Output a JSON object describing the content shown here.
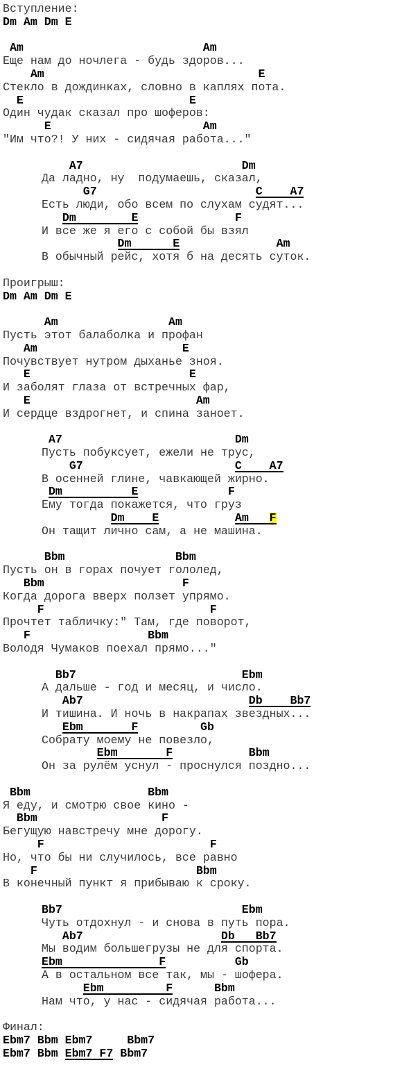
{
  "song": {
    "lines": [
      {
        "type": "label",
        "text": "Вступление:"
      },
      {
        "type": "chords",
        "segments": [
          {
            "t": "Dm Am Dm E"
          }
        ]
      },
      {
        "type": "blank"
      },
      {
        "type": "chords",
        "segments": [
          {
            "t": " Am                          Am"
          }
        ]
      },
      {
        "type": "lyric",
        "text": "Еще нам до ночлега - будь здоров..."
      },
      {
        "type": "chords",
        "segments": [
          {
            "t": "    Am                               E"
          }
        ]
      },
      {
        "type": "lyric",
        "text": "Стекло в дождинках, словно в каплях пота."
      },
      {
        "type": "chords",
        "segments": [
          {
            "t": "  E                        E"
          }
        ]
      },
      {
        "type": "lyric",
        "text": "Один чудак сказал про шоферов:"
      },
      {
        "type": "chords",
        "segments": [
          {
            "t": "      E                      Am"
          }
        ]
      },
      {
        "type": "lyric",
        "text": "\"Им что?! У них - сидячая работа...\""
      },
      {
        "type": "blank"
      },
      {
        "type": "chords",
        "indent": true,
        "segments": [
          {
            "t": "    A7                       Dm"
          }
        ]
      },
      {
        "type": "lyric",
        "indent": true,
        "text": "Да ладно, ну  подумаешь, сказал,"
      },
      {
        "type": "chords",
        "indent": true,
        "segments": [
          {
            "t": "      G7                       "
          },
          {
            "t": "C    A7",
            "u": true
          }
        ]
      },
      {
        "type": "lyric",
        "indent": true,
        "text": "Есть люди, обо всем по слухам судят..."
      },
      {
        "type": "chords",
        "indent": true,
        "segments": [
          {
            "t": "   "
          },
          {
            "t": "Dm        E",
            "u": true
          },
          {
            "t": "              F"
          }
        ]
      },
      {
        "type": "lyric",
        "indent": true,
        "text": "И все же я его с собой бы взял"
      },
      {
        "type": "chords",
        "indent": true,
        "segments": [
          {
            "t": "           "
          },
          {
            "t": "Dm      E",
            "u": true
          },
          {
            "t": "              Am"
          }
        ]
      },
      {
        "type": "lyric",
        "indent": true,
        "text": "В обычный рейс, хотя б на десять суток."
      },
      {
        "type": "blank"
      },
      {
        "type": "label",
        "text": "Проигрыш:"
      },
      {
        "type": "chords",
        "segments": [
          {
            "t": "Dm Am Dm E"
          }
        ]
      },
      {
        "type": "blank"
      },
      {
        "type": "chords",
        "segments": [
          {
            "t": "      Am                Am"
          }
        ]
      },
      {
        "type": "lyric",
        "text": "Пусть этот балаболка и профан"
      },
      {
        "type": "chords",
        "segments": [
          {
            "t": "   Am                     E"
          }
        ]
      },
      {
        "type": "lyric",
        "text": "Почувствует нутром дыханье зноя."
      },
      {
        "type": "chords",
        "segments": [
          {
            "t": "   E                       E"
          }
        ]
      },
      {
        "type": "lyric",
        "text": "И заболят глаза от встречных фар,"
      },
      {
        "type": "chords",
        "segments": [
          {
            "t": "   E                        Am"
          }
        ]
      },
      {
        "type": "lyric",
        "text": "И сердце вздрогнет, и спина заноет."
      },
      {
        "type": "blank"
      },
      {
        "type": "chords",
        "indent": true,
        "segments": [
          {
            "t": " A7                         Dm"
          }
        ]
      },
      {
        "type": "lyric",
        "indent": true,
        "text": "Пусть побуксует, ежели не трус,"
      },
      {
        "type": "chords",
        "indent": true,
        "segments": [
          {
            "t": "    G7                      "
          },
          {
            "t": "C    A7",
            "u": true
          }
        ]
      },
      {
        "type": "lyric",
        "indent": true,
        "text": "В осенней глине, чавкающей жирно."
      },
      {
        "type": "chords",
        "indent": true,
        "segments": [
          {
            "t": " "
          },
          {
            "t": "Dm          E",
            "u": true
          },
          {
            "t": "             F"
          }
        ]
      },
      {
        "type": "lyric",
        "indent": true,
        "text": "Ему тогда покажется, что груз"
      },
      {
        "type": "chords",
        "indent": true,
        "segments": [
          {
            "t": "          "
          },
          {
            "t": "Dm    E",
            "u": true
          },
          {
            "t": "           "
          },
          {
            "t": "Am   ",
            "u": true
          },
          {
            "t": "F",
            "u": true,
            "hl": true
          }
        ]
      },
      {
        "type": "lyric",
        "indent": true,
        "text": "Он тащит лично сам, а не машина."
      },
      {
        "type": "blank"
      },
      {
        "type": "chords",
        "segments": [
          {
            "t": "      Bbm                Bbm"
          }
        ]
      },
      {
        "type": "lyric",
        "text": "Пусть он в горах почует гололед,"
      },
      {
        "type": "chords",
        "segments": [
          {
            "t": "   Bbm                    F"
          }
        ]
      },
      {
        "type": "lyric",
        "text": "Когда дорога вверх ползет упрямо."
      },
      {
        "type": "chords",
        "segments": [
          {
            "t": "     F                        F"
          }
        ]
      },
      {
        "type": "lyric",
        "text": "Прочтет табличку:\" Там, где поворот,"
      },
      {
        "type": "chords",
        "segments": [
          {
            "t": "   F                 Bbm"
          }
        ]
      },
      {
        "type": "lyric",
        "text": "Володя Чумаков поехал прямо...\""
      },
      {
        "type": "blank"
      },
      {
        "type": "chords",
        "indent": true,
        "segments": [
          {
            "t": "  Bb7                        Ebm"
          }
        ]
      },
      {
        "type": "lyric",
        "indent": true,
        "text": "А дальше - год и месяц, и число."
      },
      {
        "type": "chords",
        "indent": true,
        "segments": [
          {
            "t": "   Ab7                        "
          },
          {
            "t": "Db    Bb7",
            "u": true
          }
        ]
      },
      {
        "type": "lyric",
        "indent": true,
        "text": "И тишина. И ночь в накрапах звездных..."
      },
      {
        "type": "chords",
        "indent": true,
        "segments": [
          {
            "t": "   "
          },
          {
            "t": "Ebm       F",
            "u": true
          },
          {
            "t": "         Gb"
          }
        ]
      },
      {
        "type": "lyric",
        "indent": true,
        "text": "Собрату моему не повезло,"
      },
      {
        "type": "chords",
        "indent": true,
        "segments": [
          {
            "t": "        "
          },
          {
            "t": "Ebm       F",
            "u": true
          },
          {
            "t": "           Bbm"
          }
        ]
      },
      {
        "type": "lyric",
        "indent": true,
        "text": "Он за рулём уснул - проснулся поздно..."
      },
      {
        "type": "blank"
      },
      {
        "type": "chords",
        "segments": [
          {
            "t": " Bbm                 Bbm"
          }
        ]
      },
      {
        "type": "lyric",
        "text": "Я еду, и смотрю свое кино -"
      },
      {
        "type": "chords",
        "segments": [
          {
            "t": "  Bbm                  F"
          }
        ]
      },
      {
        "type": "lyric",
        "text": "Бегущую навстречу мне дорогу."
      },
      {
        "type": "chords",
        "segments": [
          {
            "t": "     F                        F"
          }
        ]
      },
      {
        "type": "lyric",
        "text": "Но, что бы ни случилось, все равно"
      },
      {
        "type": "chords",
        "segments": [
          {
            "t": "    F                       Bbm"
          }
        ]
      },
      {
        "type": "lyric",
        "text": "В конечный пункт я прибываю к сроку."
      },
      {
        "type": "blank"
      },
      {
        "type": "chords",
        "indent": true,
        "segments": [
          {
            "t": "Bb7                          Ebm"
          }
        ]
      },
      {
        "type": "lyric",
        "indent": true,
        "text": "Чуть отдохнул - и снова в путь пора."
      },
      {
        "type": "chords",
        "indent": true,
        "segments": [
          {
            "t": "   Ab7                    "
          },
          {
            "t": "Db   Bb7",
            "u": true
          }
        ]
      },
      {
        "type": "lyric",
        "indent": true,
        "text": "Мы водим большегрузы не для спорта."
      },
      {
        "type": "chords",
        "indent": true,
        "segments": [
          {
            "t": "Ebm              F",
            "u": true
          },
          {
            "t": "          Gb"
          }
        ]
      },
      {
        "type": "lyric",
        "indent": true,
        "text": "А в остальном все так, мы - шофера."
      },
      {
        "type": "chords",
        "indent": true,
        "segments": [
          {
            "t": "      "
          },
          {
            "t": "Ebm         F",
            "u": true
          },
          {
            "t": "      Bbm"
          }
        ]
      },
      {
        "type": "lyric",
        "indent": true,
        "text": "Нам что, у нас - сидячая работа..."
      },
      {
        "type": "blank"
      },
      {
        "type": "label",
        "text": "Финал:"
      },
      {
        "type": "chords",
        "segments": [
          {
            "t": "Ebm7 Bbm Ebm7     Bbm7"
          }
        ]
      },
      {
        "type": "chords",
        "segments": [
          {
            "t": "Ebm7 Bbm "
          },
          {
            "t": "Ebm7 F7",
            "u": true
          },
          {
            "t": " Bbm7"
          }
        ]
      }
    ]
  },
  "colors": {
    "lyric": "#3a3a3a",
    "chord": "#000000",
    "highlight": "#ffff00"
  }
}
